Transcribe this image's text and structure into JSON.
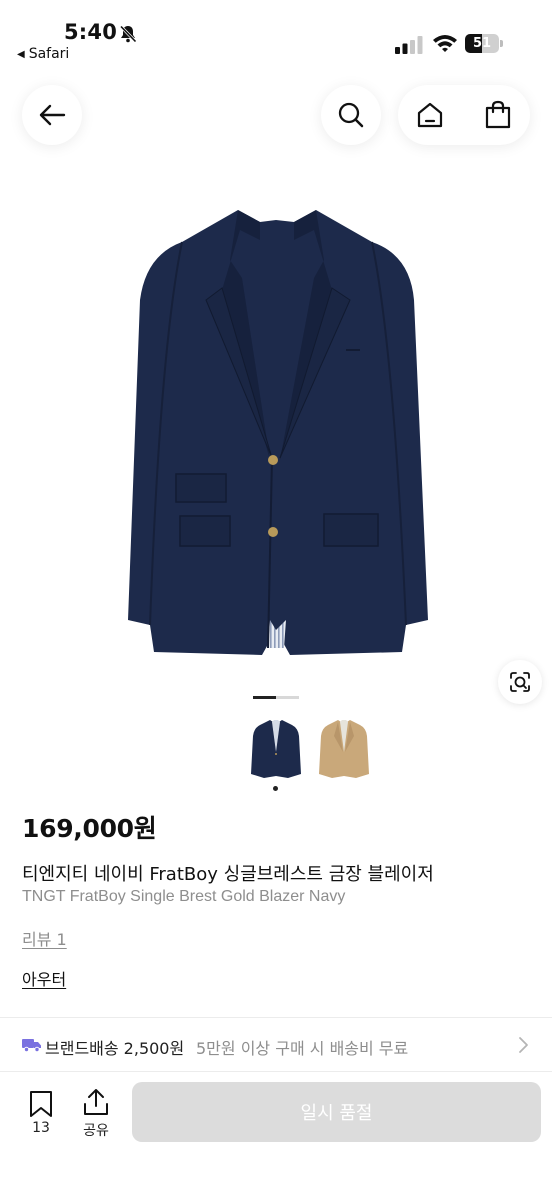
{
  "status_bar": {
    "time": "5:40",
    "back_app": "Safari",
    "battery_level": "51",
    "battery_fraction": 0.51
  },
  "nav": {
    "icons": [
      "arrow-left-icon",
      "search-icon",
      "home-icon",
      "shopping-bag-icon"
    ]
  },
  "gallery": {
    "pager_total": 2,
    "pager_current": 1,
    "thumbnails": [
      {
        "color_name": "navy",
        "color": "#1d2a4b"
      },
      {
        "color_name": "beige",
        "color": "#c9a87a"
      }
    ],
    "selected_thumbnail": 1
  },
  "product": {
    "price": "169,000원",
    "title_ko": "티엔지티 네이비 FratBoy 싱글브레스트 금장 블레이저",
    "title_en": "TNGT FratBoy Single Brest Gold Blazer Navy",
    "review_link": "리뷰 1",
    "category": "아우터"
  },
  "shipping": {
    "label": "브랜드배송 2,500원",
    "note": "5만원 이상 구매 시 배송비 무료",
    "icon_color": "#7a71e0"
  },
  "bottom_bar": {
    "bookmark_count": "13",
    "share_label": "공유",
    "soldout_label": "일시 품절"
  },
  "colors": {
    "jacket": "#1d2a4b",
    "accent_purple": "#7a71e0",
    "soldout_bg": "#dcdcdc"
  }
}
